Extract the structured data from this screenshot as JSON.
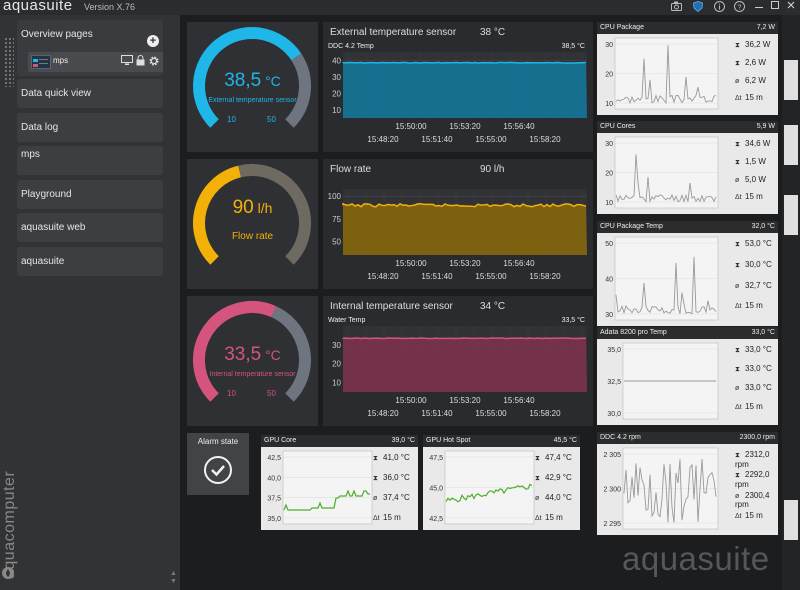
{
  "app": {
    "title": "aquasuite",
    "version": "Version X.76",
    "brand_vertical": "aquacomputer",
    "watermark": "aquasuite"
  },
  "title_icons": [
    "camera-icon",
    "shield-icon",
    "info-icon",
    "help-icon",
    "minimize-icon",
    "maximize-icon",
    "close-icon"
  ],
  "sidebar": {
    "items": [
      {
        "label": "Overview pages"
      },
      {
        "label": "Data quick view"
      },
      {
        "label": "Data log"
      },
      {
        "label": "mps"
      },
      {
        "label": "Playground"
      },
      {
        "label": "aquasuite web"
      },
      {
        "label": "aquasuite"
      }
    ],
    "sub_item": {
      "label": "mps"
    }
  },
  "gauges": [
    {
      "value": "38,5",
      "unit": "°C",
      "label": "External temperature sensor",
      "tick_min": "10",
      "tick_max": "50",
      "color": "#1fb6e8",
      "fraction": 0.71
    },
    {
      "value": "90",
      "unit": "l/h",
      "label": "Flow rate",
      "tick_min": "",
      "tick_max": "",
      "color": "#f2b008",
      "fraction": 0.45
    },
    {
      "value": "33,5",
      "unit": "°C",
      "label": "Internal temperature sensor",
      "tick_min": "10",
      "tick_max": "50",
      "color": "#d4547e",
      "fraction": 0.59
    }
  ],
  "charts": [
    {
      "title": "External temperature sensor",
      "value": "38 °C",
      "sub_title": "DDC 4.2 Temp",
      "sub_value": "38,5 °C",
      "color": "#1fb6e8",
      "fill": "#127a9e",
      "y_ticks": [
        "40",
        "30",
        "20",
        "10"
      ],
      "level": 38.5,
      "ymin": 5,
      "ymax": 45,
      "x_ticks_top": [
        "15:50:00",
        "15:53:20",
        "15:56:40"
      ],
      "x_ticks_bottom": [
        "15:48:20",
        "15:51:40",
        "15:55:00",
        "15:58:20"
      ]
    },
    {
      "title": "Flow rate",
      "value": "90 l/h",
      "sub_title": "",
      "sub_value": "",
      "color": "#f2b008",
      "fill": "#8a6a0a",
      "y_ticks": [
        "100",
        "75",
        "50"
      ],
      "level": 90,
      "ymin": 35,
      "ymax": 108,
      "x_ticks_top": [
        "15:50:00",
        "15:53:20",
        "15:56:40"
      ],
      "x_ticks_bottom": [
        "15:48:20",
        "15:51:40",
        "15:55:00",
        "15:58:20"
      ]
    },
    {
      "title": "Internal temperature sensor",
      "value": "34 °C",
      "sub_title": "Water Temp",
      "sub_value": "33,5 °C",
      "color": "#d4547e",
      "fill": "#80334d",
      "y_ticks": [
        "30",
        "20",
        "10"
      ],
      "level": 33.5,
      "ymin": 5,
      "ymax": 40,
      "x_ticks_top": [
        "15:50:00",
        "15:53:20",
        "15:56:40"
      ],
      "x_ticks_bottom": [
        "15:48:20",
        "15:51:40",
        "15:55:00",
        "15:58:20"
      ]
    }
  ],
  "mini": [
    {
      "title": "CPU Package",
      "value": "7,2 W",
      "y_ticks": [
        "30",
        "20",
        "10"
      ],
      "max": "36,2 W",
      "min": "2,6 W",
      "avg": "6,2 W",
      "span": "15 m"
    },
    {
      "title": "CPU Cores",
      "value": "5,9 W",
      "y_ticks": [
        "30",
        "20",
        "10"
      ],
      "max": "34,6 W",
      "min": "1,5 W",
      "avg": "5,0 W",
      "span": "15 m"
    },
    {
      "title": "CPU Package Temp",
      "value": "32,0 °C",
      "y_ticks": [
        "50",
        "40",
        "30"
      ],
      "max": "53,0 °C",
      "min": "30,0 °C",
      "avg": "32,7 °C",
      "span": "15 m"
    },
    {
      "title": "Adata 8200 pro Temp",
      "value": "33,0 °C",
      "y_ticks": [
        "35,0",
        "32,5",
        "30,0"
      ],
      "max": "33,0 °C",
      "min": "33,0 °C",
      "avg": "33,0 °C",
      "span": "15 m"
    },
    {
      "title": "DDC 4.2 rpm",
      "value": "2300,0 rpm",
      "y_ticks": [
        "2 305",
        "2 300",
        "2 295"
      ],
      "max": "2312,0 rpm",
      "min": "2292,0 rpm",
      "avg": "2300,4 rpm",
      "span": "15 m"
    }
  ],
  "alarm": {
    "label": "Alarm state"
  },
  "bottom": [
    {
      "title": "GPU Core",
      "value": "39,0 °C",
      "y_ticks": [
        "42,5",
        "40,0",
        "37,5",
        "35,0"
      ],
      "max": "41,0 °C",
      "min": "36,0 °C",
      "avg": "37,4 °C",
      "span": "15 m"
    },
    {
      "title": "GPU Hot Spot",
      "value": "45,5 °C",
      "y_ticks": [
        "47,5",
        "45,0",
        "42,5"
      ],
      "max": "47,4 °C",
      "min": "42,9 °C",
      "avg": "44,0 °C",
      "span": "15 m"
    }
  ]
}
